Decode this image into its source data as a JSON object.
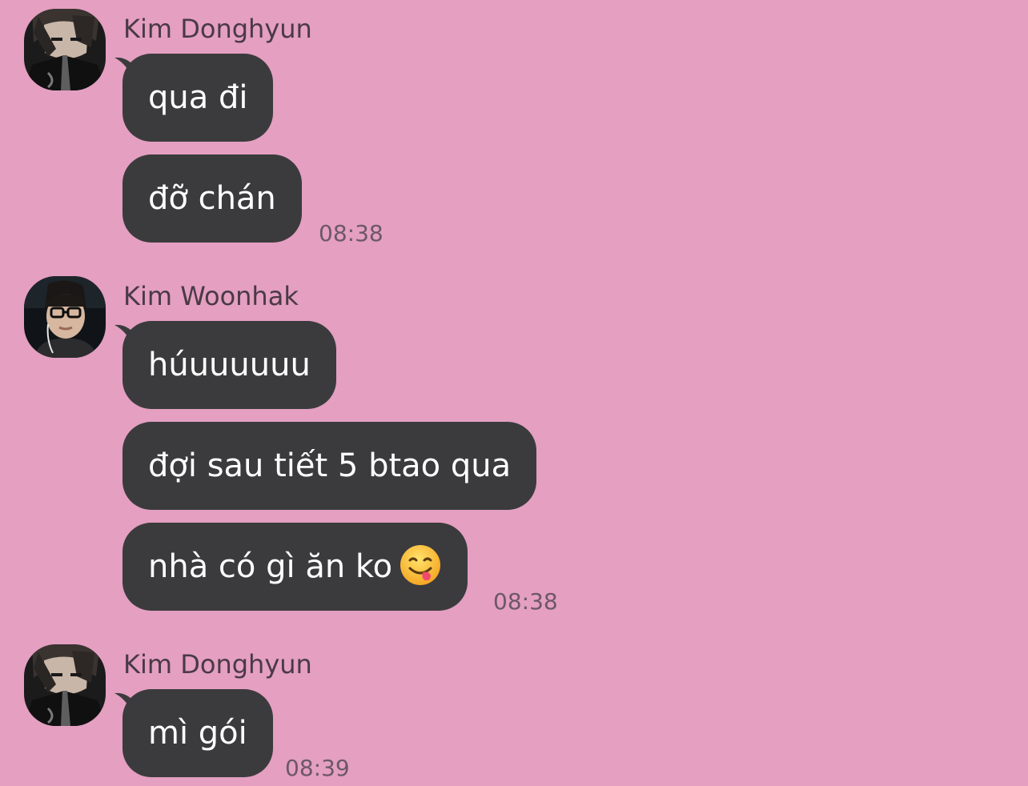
{
  "colors": {
    "background": "#e49fc1",
    "bubble": "#3b3b3d",
    "bubble_text": "#ffffff",
    "sender_text": "#4a3a44",
    "timestamp_text": "#6d5865"
  },
  "messages": [
    {
      "sender": "Kim Donghyun",
      "avatar_icon": "profile-photo-donghyun",
      "bubbles": [
        "qua đi",
        "đỡ chán"
      ],
      "time": "08:38"
    },
    {
      "sender": "Kim Woonhak",
      "avatar_icon": "profile-photo-woonhak",
      "bubbles": [
        "húuuuuuu",
        "đợi sau tiết 5 btao qua",
        "nhà có gì ăn ko"
      ],
      "bubble_emoji": "face-savoring-food-emoji",
      "time": "08:38"
    },
    {
      "sender": "Kim Donghyun",
      "avatar_icon": "profile-photo-donghyun",
      "bubbles": [
        "mì gói"
      ],
      "time": "08:39"
    }
  ]
}
